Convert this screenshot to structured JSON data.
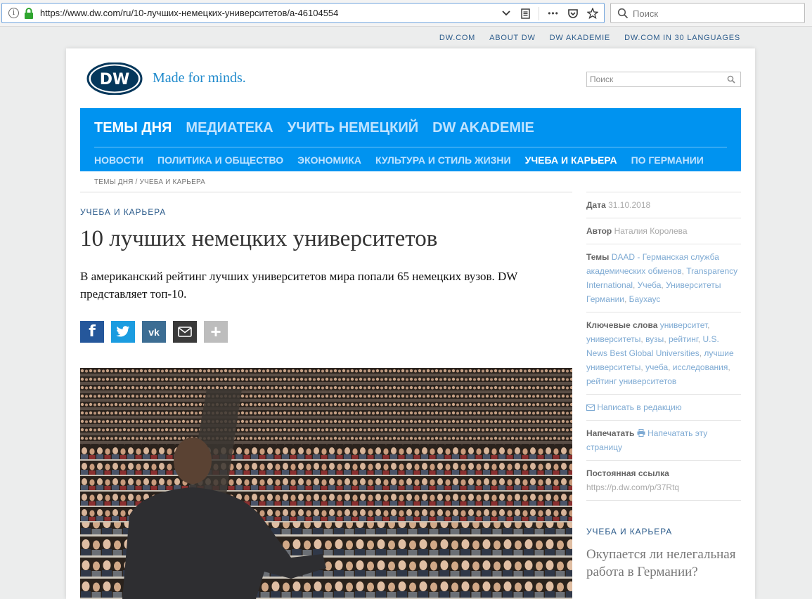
{
  "browser": {
    "url": "https://www.dw.com/ru/10-лучших-немецких-университетов/a-46104554",
    "search_placeholder": "Поиск",
    "more_dots": "•••"
  },
  "top_links": [
    "DW.COM",
    "ABOUT DW",
    "DW AKADEMIE",
    "DW.COM IN 30 LANGUAGES"
  ],
  "header": {
    "logo_text": "DW",
    "tagline": "Made for minds.",
    "search_placeholder": "Поиск"
  },
  "nav": {
    "main": [
      {
        "label": "ТЕМЫ ДНЯ",
        "active": true
      },
      {
        "label": "МЕДИАТЕКА",
        "active": false
      },
      {
        "label": "УЧИТЬ НЕМЕЦКИЙ",
        "active": false
      },
      {
        "label": "DW AKADEMIE",
        "active": false
      }
    ],
    "sub": [
      {
        "label": "НОВОСТИ",
        "active": false
      },
      {
        "label": "ПОЛИТИКА И ОБЩЕСТВО",
        "active": false
      },
      {
        "label": "ЭКОНОМИКА",
        "active": false
      },
      {
        "label": "КУЛЬТУРА И СТИЛЬ ЖИЗНИ",
        "active": false
      },
      {
        "label": "УЧЕБА И КАРЬЕРА",
        "active": true
      },
      {
        "label": "ПО ГЕРМАНИИ",
        "active": false
      }
    ]
  },
  "breadcrumb": {
    "first": "ТЕМЫ ДНЯ",
    "sep": " / ",
    "second": "УЧЕБА И КАРЬЕРА"
  },
  "article": {
    "kicker": "УЧЕБА И КАРЬЕРА",
    "headline": "10 лучших немецких университетов",
    "teaser": "В американский рейтинг лучших университетов мира попали 65 немецких вузов. DW представляет топ-10."
  },
  "share": {
    "fb": "f",
    "vk": "vk",
    "plus": "+"
  },
  "sidebar": {
    "date_label": "Дата",
    "date_value": "31.10.2018",
    "author_label": "Автор",
    "author_value": "Наталия Королева",
    "topics_label": "Темы",
    "topics": [
      "DAAD - Германская служба академических обменов",
      "Transparency International",
      "Учеба",
      "Университеты Германии",
      "Баухаус"
    ],
    "keywords_label": "Ключевые слова",
    "keywords": [
      "университет",
      "университеты",
      "вузы",
      "рейтинг",
      "U.S. News Best Global Universities",
      "лучшие университеты",
      "учеба",
      "исследования",
      "рейтинг университетов"
    ],
    "write_link": "Написать в редакцию",
    "print_label": "Напечатать",
    "print_link": "Напечатать эту страницу",
    "permalink_label": "Постоянная ссылка",
    "permalink_value": "https://p.dw.com/p/37Rtq",
    "related_kicker": "УЧЕБА И КАРЬЕРА",
    "related_headline": "Окупается ли нелегальная работа в Германии?"
  },
  "colors": {
    "nav_blue": "#0093f0",
    "link_dark": "#2b5b8b",
    "link_light": "#7eaad3",
    "logo_navy": "#05375b"
  }
}
